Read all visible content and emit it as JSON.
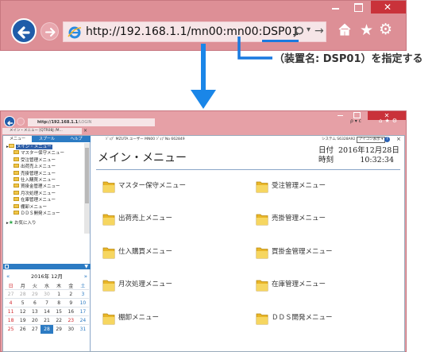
{
  "zoom_bar": {
    "url_prefix": "http://192.168.1.1/mn00:mn00:",
    "url_highlight": "DSP01",
    "annotation": "（装置名: DSP01）を指定する"
  },
  "browser": {
    "address_bold": "http://192.168.1.1",
    "address_rest": "/LOGIN",
    "address_right": "ρ ▾ c",
    "tab_title": "メイン・メニュー [QTR08J /M..."
  },
  "left_pane": {
    "tabs": [
      "メニュー",
      "スプール",
      "ヘルプ"
    ],
    "tree_root": "メイン・メニュー",
    "tree_items": [
      "マスター保守メニュー",
      "受注管理メニュー",
      "出荷売上メニュー",
      "売掛管理メニュー",
      "仕入購買メニュー",
      "買掛金管理メニュー",
      "月次処理メニュー",
      "在庫管理メニュー",
      "棚卸メニュー",
      "ＤＤＳ開発メニュー"
    ],
    "favorites": "お気に入り"
  },
  "calendar": {
    "prev": "«",
    "next": "»",
    "month_label": "2016年 12月",
    "weekdays": [
      "日",
      "月",
      "火",
      "水",
      "木",
      "金",
      "土"
    ],
    "weeks": [
      [
        "27",
        "28",
        "29",
        "30",
        "1",
        "2",
        "3"
      ],
      [
        "4",
        "5",
        "6",
        "7",
        "8",
        "9",
        "10"
      ],
      [
        "11",
        "12",
        "13",
        "14",
        "15",
        "16",
        "17"
      ],
      [
        "18",
        "19",
        "20",
        "21",
        "22",
        "23",
        "24"
      ],
      [
        "25",
        "26",
        "27",
        "28",
        "29",
        "30",
        "31"
      ]
    ],
    "today": "28"
  },
  "main": {
    "info_left": "ｼﾞｮﾌﾞ  MZUTA    ユーザー  MN00     ｼﾞｮﾌﾞNo  662849",
    "info_right_label": "システム  S6328A92",
    "info_select": "アイコン表示",
    "title": "メイン・メニュー",
    "date_key": "日付",
    "date_value": "2016年12月28日",
    "time_key": "時刻",
    "time_value": "10:32:34",
    "menu_items": [
      "マスター保守メニュー",
      "受注管理メニュー",
      "出荷売上メニュー",
      "売掛管理メニュー",
      "仕入購買メニュー",
      "買掛金管理メニュー",
      "月次処理メニュー",
      "在庫管理メニュー",
      "棚卸メニュー",
      "ＤＤＳ開発メニュー"
    ]
  },
  "colors": {
    "chrome": "#dd8f96",
    "accent_blue": "#2c7bc3",
    "highlight_underline": "#1a7ae0",
    "folder_yellow": "#f0c64a"
  }
}
